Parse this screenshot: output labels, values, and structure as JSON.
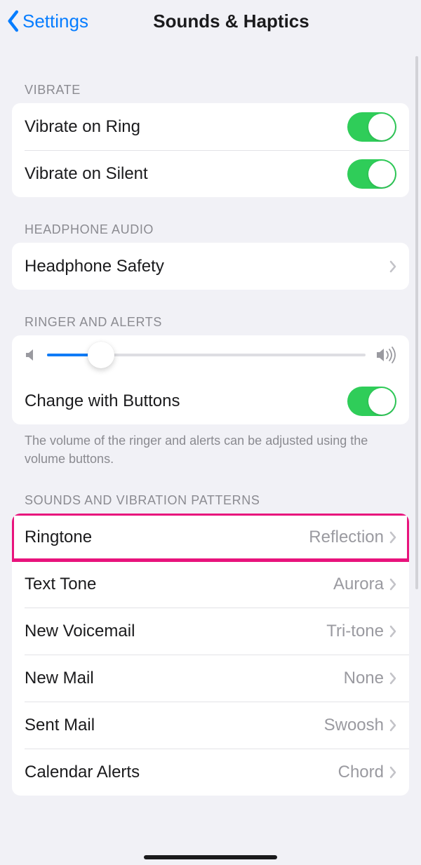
{
  "header": {
    "back_label": "Settings",
    "title": "Sounds & Haptics"
  },
  "sections": {
    "vibrate": {
      "header": "VIBRATE",
      "items": [
        {
          "label": "Vibrate on Ring",
          "on": true
        },
        {
          "label": "Vibrate on Silent",
          "on": true
        }
      ]
    },
    "headphone": {
      "header": "HEADPHONE AUDIO",
      "item": {
        "label": "Headphone Safety"
      }
    },
    "ringer": {
      "header": "RINGER AND ALERTS",
      "slider_percent": 17,
      "change_label": "Change with Buttons",
      "change_on": true,
      "footer": "The volume of the ringer and alerts can be adjusted using the volume buttons."
    },
    "sounds": {
      "header": "SOUNDS AND VIBRATION PATTERNS",
      "items": [
        {
          "label": "Ringtone",
          "value": "Reflection",
          "highlight": true
        },
        {
          "label": "Text Tone",
          "value": "Aurora"
        },
        {
          "label": "New Voicemail",
          "value": "Tri-tone"
        },
        {
          "label": "New Mail",
          "value": "None"
        },
        {
          "label": "Sent Mail",
          "value": "Swoosh"
        },
        {
          "label": "Calendar Alerts",
          "value": "Chord"
        }
      ]
    }
  }
}
